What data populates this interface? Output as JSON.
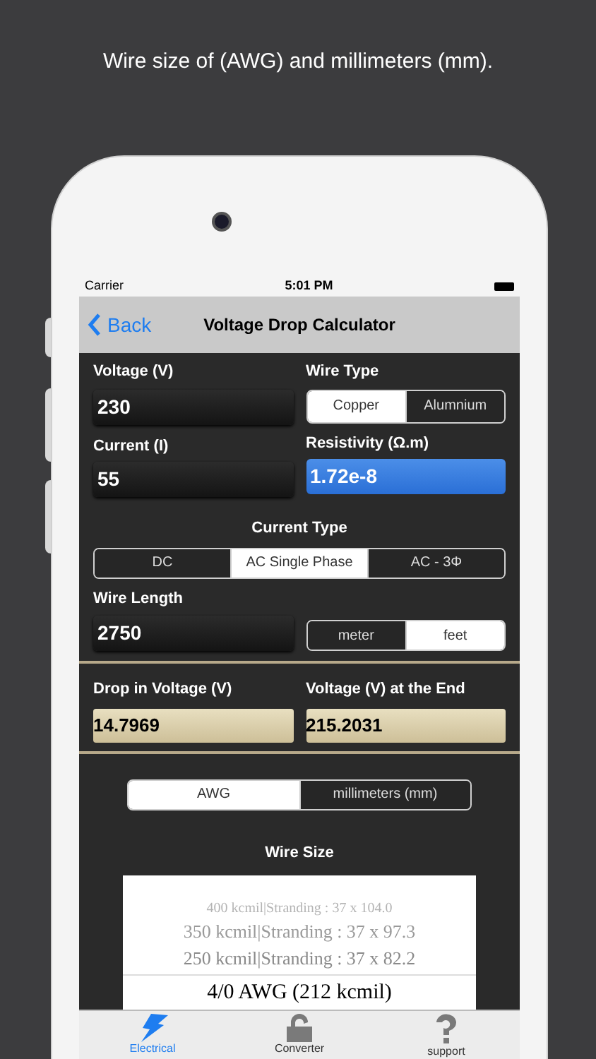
{
  "caption": "Wire size of (AWG) and millimeters (mm).",
  "status_bar": {
    "carrier": "Carrier",
    "time": "5:01 PM"
  },
  "nav": {
    "back": "Back",
    "title": "Voltage Drop Calculator"
  },
  "voltage": {
    "label": "Voltage (V)",
    "value": "230",
    "focused": false
  },
  "wire_type": {
    "label": "Wire Type",
    "options": [
      {
        "label": "Copper",
        "selected": true
      },
      {
        "label": "Alumnium",
        "selected": false
      }
    ]
  },
  "current": {
    "label": "Current (I)",
    "value": "55",
    "focused": false
  },
  "resistivity": {
    "label": "Resistivity (Ω.m)",
    "value": "1.72e-8",
    "focused": true
  },
  "current_type": {
    "label": "Current Type",
    "options": [
      {
        "label": "DC",
        "selected": false
      },
      {
        "label": "AC Single Phase",
        "selected": true
      },
      {
        "label": "AC - 3Φ",
        "selected": false
      }
    ]
  },
  "wire_length": {
    "label": "Wire Length",
    "value": "2750",
    "focused": false,
    "units": [
      {
        "label": "meter",
        "selected": false
      },
      {
        "label": "feet",
        "selected": true
      }
    ]
  },
  "results": [
    {
      "label": "Drop in Voltage (V)",
      "value": "14.7969"
    },
    {
      "label": "Voltage (V) at the End",
      "value": "215.2031"
    }
  ],
  "size_unit": {
    "options": [
      {
        "label": "AWG",
        "selected": true
      },
      {
        "label": "millimeters (mm)",
        "selected": false
      }
    ]
  },
  "wire_size": {
    "label": "Wire Size",
    "rows": [
      {
        "text": "400 kcmil|Stranding : 37 x 104.0",
        "selected": false
      },
      {
        "text": "350 kcmil|Stranding : 37 x 97.3",
        "selected": false
      },
      {
        "text": "250 kcmil|Stranding : 37 x 82.2",
        "selected": false
      },
      {
        "text": "4/0 AWG (212  kcmil)",
        "selected": true
      }
    ]
  },
  "tab_bar": [
    {
      "label": "Electrical",
      "kind": "bolt",
      "selected": true
    },
    {
      "label": "Converter",
      "kind": "lock",
      "selected": false
    },
    {
      "label": "support",
      "kind": "question",
      "selected": false
    }
  ]
}
